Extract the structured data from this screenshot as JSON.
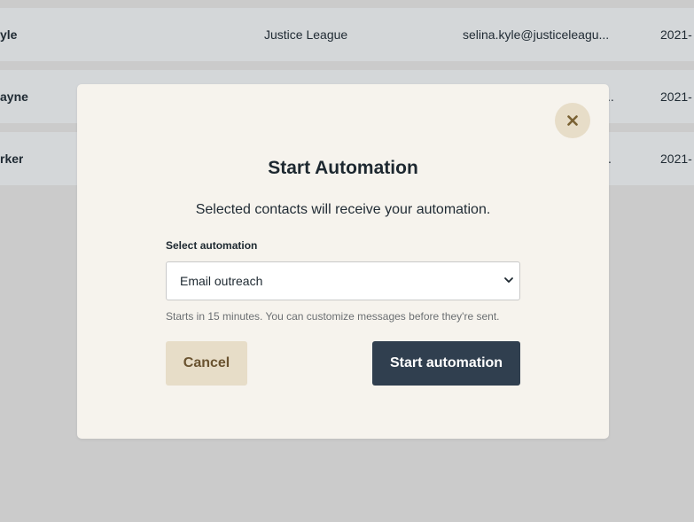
{
  "background_table": {
    "rows": [
      {
        "name": "yle",
        "organization": "Justice League",
        "email": "selina.kyle@justiceleagu...",
        "date": "2021-"
      },
      {
        "name": "ayne",
        "organization": "",
        "email": "..",
        "date": "2021-"
      },
      {
        "name": "rker",
        "organization": "",
        "email": ".",
        "date": "2021-"
      }
    ]
  },
  "modal": {
    "title": "Start Automation",
    "description": "Selected contacts will receive your automation.",
    "close_icon": "close-icon",
    "select": {
      "label": "Select automation",
      "selected_value": "Email outreach"
    },
    "hint": "Starts in 15 minutes. You can customize messages before they're sent.",
    "cancel_label": "Cancel",
    "start_label": "Start automation"
  },
  "colors": {
    "overlay_background": "#cbcbcb",
    "modal_background": "#f6f3ed",
    "close_button": "#e7ddc8",
    "cancel_button": "#e7ddc8",
    "primary_button": "#303f4f"
  }
}
